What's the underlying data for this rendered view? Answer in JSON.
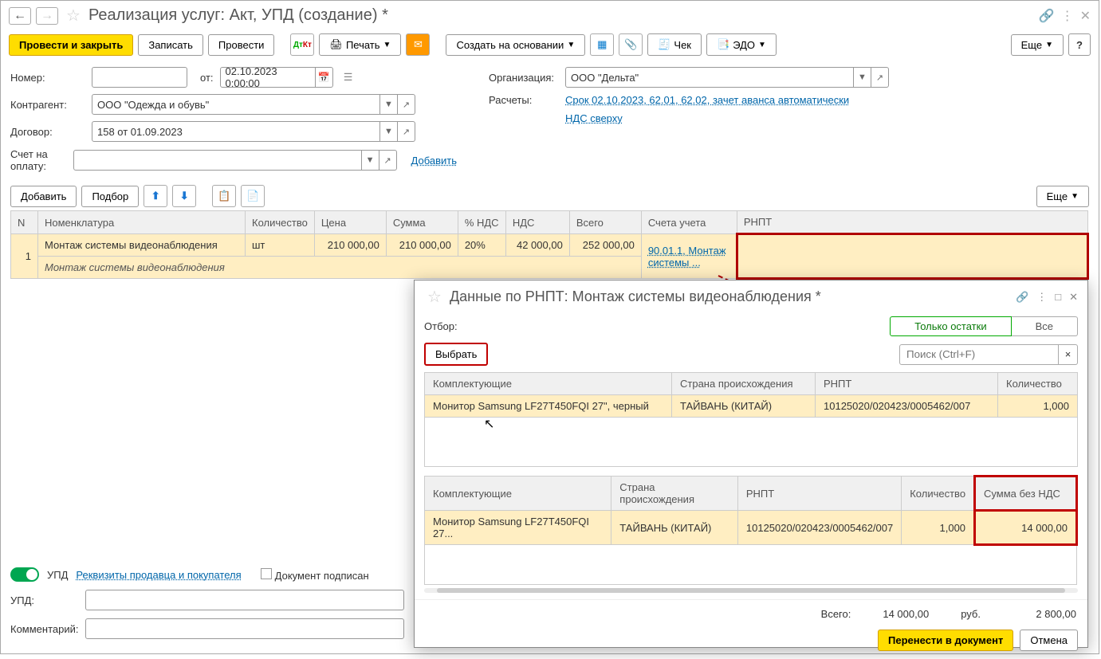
{
  "title": "Реализация услуг: Акт, УПД (создание) *",
  "toolbar": {
    "post_close": "Провести и закрыть",
    "save": "Записать",
    "post": "Провести",
    "print": "Печать",
    "create_based": "Создать на основании",
    "cheque": "Чек",
    "edo": "ЭДО",
    "more": "Еще",
    "help": "?"
  },
  "form": {
    "number_label": "Номер:",
    "from_label": "от:",
    "date_value": "02.10.2023  0:00:00",
    "org_label": "Организация:",
    "org_value": "ООО \"Дельта\"",
    "contragent_label": "Контрагент:",
    "contragent_value": "ООО \"Одежда и обувь\"",
    "calc_label": "Расчеты:",
    "calc_link": "Срок 02.10.2023, 62.01, 62.02, зачет аванса автоматически",
    "contract_label": "Договор:",
    "contract_value": "158 от 01.09.2023",
    "nds_link": "НДС сверху",
    "invoice_label": "Счет на оплату:",
    "add_link": "Добавить"
  },
  "tablebar": {
    "add": "Добавить",
    "pick": "Подбор",
    "more": "Еще"
  },
  "table": {
    "headers": {
      "n": "N",
      "nomen": "Номенклатура",
      "qty": "Количество",
      "price": "Цена",
      "sum": "Сумма",
      "vat_pct": "% НДС",
      "vat": "НДС",
      "total": "Всего",
      "accounts": "Счета учета",
      "rnpt": "РНПТ"
    },
    "rows": [
      {
        "n": "1",
        "nomen": "Монтаж системы видеонаблюдения",
        "nomen_sub": "Монтаж системы видеонаблюдения",
        "qty": "шт",
        "price": "210 000,00",
        "sum": "210 000,00",
        "vat_pct": "20%",
        "vat": "42 000,00",
        "total": "252 000,00",
        "accounts": "90.01.1, Монтаж системы ..."
      }
    ]
  },
  "footer": {
    "upd_toggle": "УПД",
    "seller_buyer": "Реквизиты продавца и покупателя",
    "doc_signed": "Документ подписан",
    "upd_label": "УПД:",
    "comment": "Комментарий:"
  },
  "modal": {
    "title": "Данные по РНПТ: Монтаж системы видеонаблюдения *",
    "filter_label": "Отбор:",
    "seg_balances": "Только остатки",
    "seg_all": "Все",
    "select_btn": "Выбрать",
    "search_ph": "Поиск (Ctrl+F)",
    "grid1": {
      "headers": {
        "item": "Комплектующие",
        "country": "Страна происхождения",
        "rnpt": "РНПТ",
        "qty": "Количество"
      },
      "row": {
        "item": "Монитор Samsung LF27T450FQI 27\", черный",
        "country": "ТАЙВАНЬ (КИТАЙ)",
        "rnpt": "10125020/020423/0005462/007",
        "qty": "1,000"
      }
    },
    "grid2": {
      "headers": {
        "item": "Комплектующие",
        "country": "Страна происхождения",
        "rnpt": "РНПТ",
        "qty": "Количество",
        "sum": "Сумма без НДС"
      },
      "row": {
        "item": "Монитор Samsung LF27T450FQI 27...",
        "country": "ТАЙВАНЬ (КИТАЙ)",
        "rnpt": "10125020/020423/0005462/007",
        "qty": "1,000",
        "sum": "14 000,00"
      }
    },
    "totals": {
      "label": "Всего:",
      "sum": "14 000,00",
      "rub": "руб.",
      "sum2": "2 800,00"
    },
    "footer": {
      "transfer": "Перенести в документ",
      "cancel": "Отмена"
    }
  }
}
